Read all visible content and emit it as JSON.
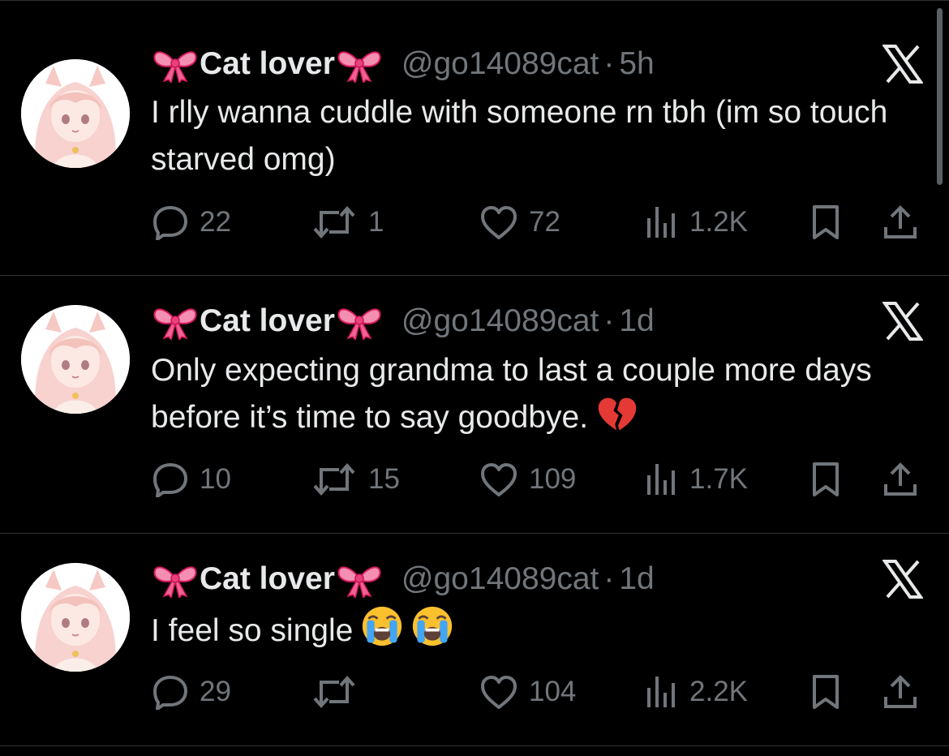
{
  "colors": {
    "background": "#000000",
    "text": "#e7e9ea",
    "secondary": "#71767b",
    "divider": "#2f3336",
    "bow": "#f06292"
  },
  "tweets": [
    {
      "display_name": "Cat lover",
      "handle": "@go14089cat",
      "separator": "·",
      "time": "5h",
      "text": "I rlly wanna cuddle with someone rn tbh (im so touch starved omg)",
      "emojis": [],
      "replies": "22",
      "retweets": "1",
      "likes": "72",
      "views": "1.2K"
    },
    {
      "display_name": "Cat lover",
      "handle": "@go14089cat",
      "separator": "·",
      "time": "1d",
      "text": "Only expecting grandma to last a couple more days before it’s time to say goodbye.",
      "emojis": [
        "broken-heart-icon"
      ],
      "replies": "10",
      "retweets": "15",
      "likes": "109",
      "views": "1.7K"
    },
    {
      "display_name": "Cat lover",
      "handle": "@go14089cat",
      "separator": "·",
      "time": "1d",
      "text": "I feel so single",
      "emojis": [
        "loudly-crying-face-icon",
        "loudly-crying-face-icon"
      ],
      "replies": "29",
      "retweets": "",
      "likes": "104",
      "views": "2.2K"
    }
  ]
}
